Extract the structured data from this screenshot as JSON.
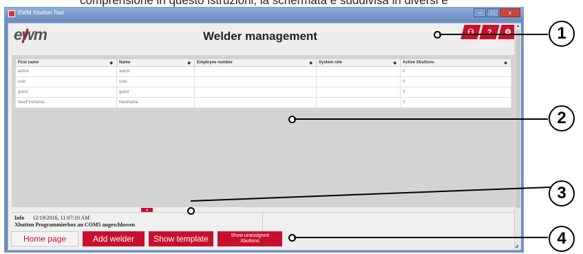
{
  "caption_fragment": "comprensione in questo istruzioni, la schermata è suddivisa in diversi e",
  "window": {
    "title": "EWM Xbutton Tool",
    "controls": {
      "minimize": "–",
      "maximize": "□",
      "close": "x"
    }
  },
  "header": {
    "logo": "ewm",
    "title": "Welder management",
    "tabs": [
      {
        "icon": "users-icon",
        "glyph": "⚇"
      },
      {
        "icon": "help-icon",
        "glyph": "?"
      },
      {
        "icon": "settings-icon",
        "glyph": "⚙"
      }
    ]
  },
  "table": {
    "columns": [
      "First name",
      "Name",
      "Employee number",
      "System role",
      "Active Xbuttons"
    ],
    "sort_glyph": "◆",
    "rows": [
      [
        "admin",
        "admin",
        "",
        "",
        "0"
      ],
      [
        "user",
        "user",
        "",
        "",
        "0"
      ],
      [
        "guest",
        "guest",
        "",
        "",
        "0"
      ],
      [
        "NewFirstname",
        "NewName",
        "",
        "",
        "0"
      ]
    ]
  },
  "info": {
    "expand_glyph": "▲",
    "label": "Info",
    "timestamp": "12/19/2016, 11:07:10 AM",
    "message": "Xbutton Programmierbox an COM5 angeschlossen"
  },
  "buttons": {
    "home": "Home page",
    "add_welder": "Add welder",
    "show_template": "Show template",
    "show_unassigned_line1": "Show unassigned",
    "show_unassigned_line2": "Xbuttons"
  },
  "callouts": [
    "1",
    "2",
    "3",
    "4"
  ],
  "colors": {
    "accent": "#c8102e",
    "grid_area": "#d3d3d3"
  }
}
